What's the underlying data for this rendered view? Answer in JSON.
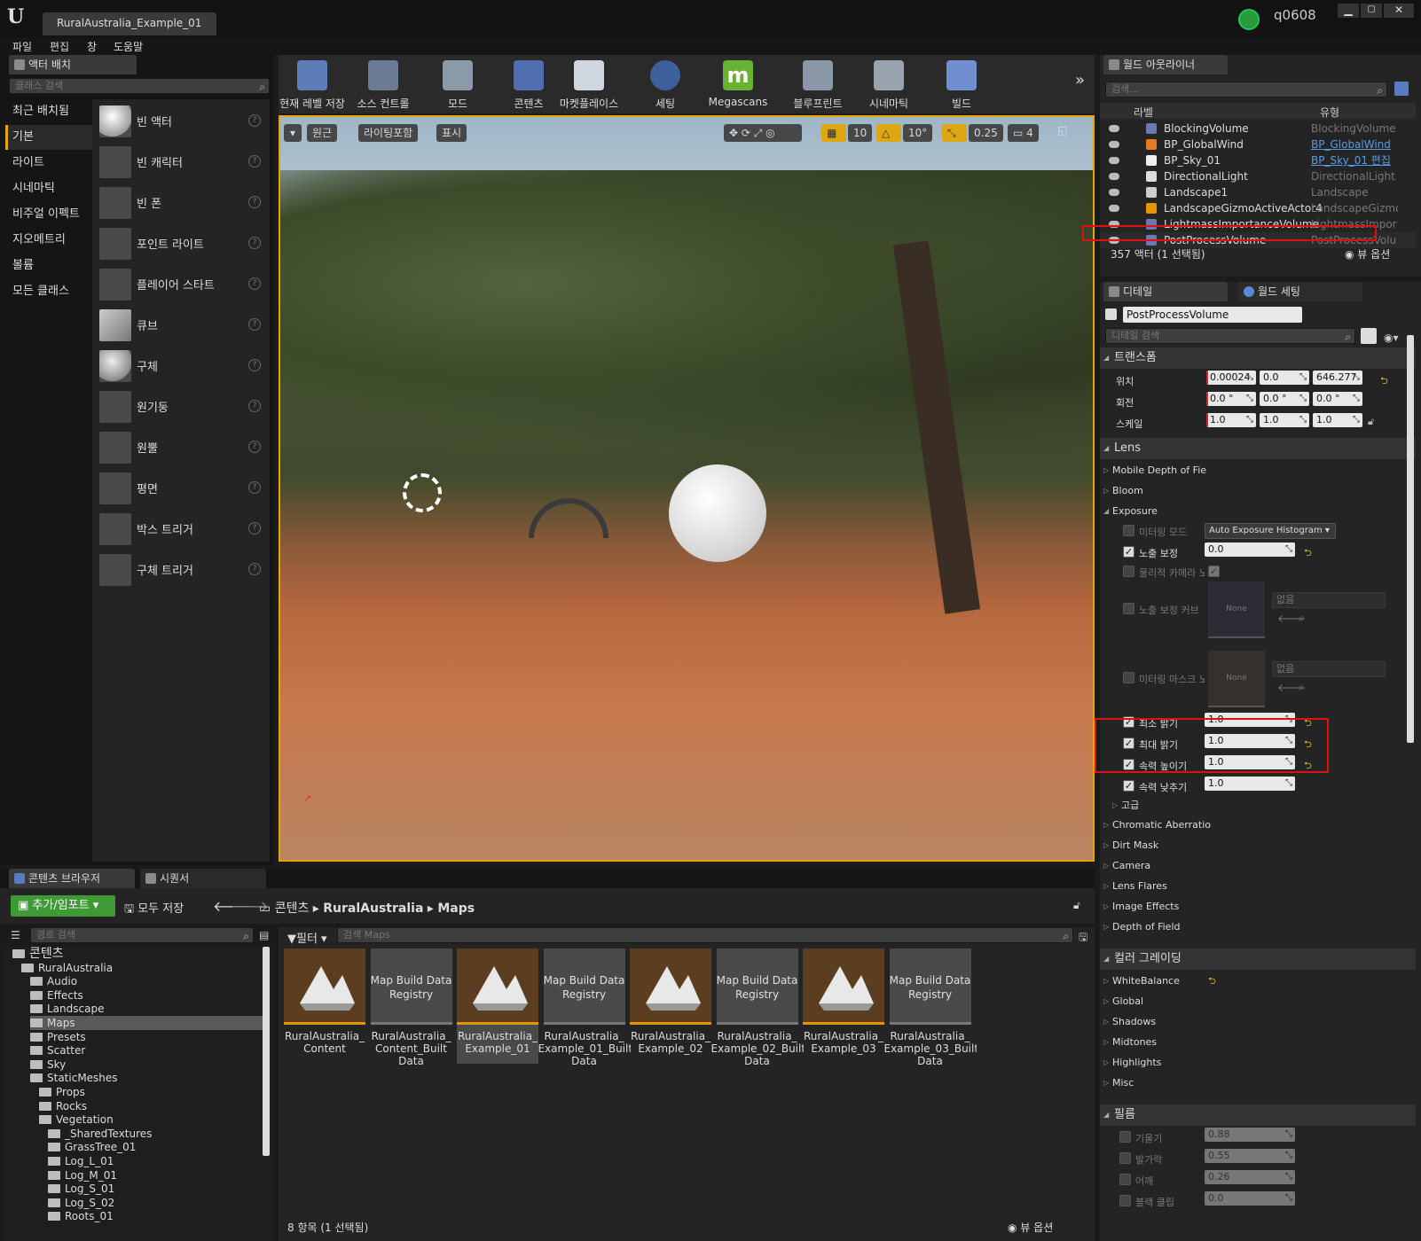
{
  "window": {
    "tab_title": "RuralAustralia_Example_01",
    "user": "q0608"
  },
  "menu": [
    "파일",
    "편집",
    "창",
    "도움말"
  ],
  "place_actors": {
    "tab_label": "액터 배치",
    "search_placeholder": "클래스 검색",
    "categories": [
      "최근 배치됨",
      "기본",
      "라이트",
      "시네마틱",
      "비주얼 이펙트",
      "지오메트리",
      "볼륨",
      "모든 클래스"
    ],
    "selected_category": "기본",
    "items": [
      "빈 액터",
      "빈 캐릭터",
      "빈 폰",
      "포인트 라이트",
      "플레이어 스타트",
      "큐브",
      "구체",
      "원기둥",
      "원뿔",
      "평면",
      "박스 트리거",
      "구체 트리거"
    ]
  },
  "toolbar": {
    "buttons": [
      "현재 레벨 저장",
      "소스 컨트롤",
      "모드",
      "콘텐츠",
      "마켓플레이스",
      "세팅",
      "Megascans",
      "블루프린트",
      "시네마틱",
      "빌드"
    ]
  },
  "viewport": {
    "view_mode": "원근",
    "lighting": "라이팅포함",
    "show": "표시",
    "grid_snap": "10",
    "rot_snap": "10°",
    "scale_snap": "0.25",
    "cam_speed": "4"
  },
  "outliner": {
    "tab_label": "월드 아웃라이너",
    "search_placeholder": "검색...",
    "col_label": "라벨",
    "col_type": "유형",
    "rows": [
      {
        "name": "BlockingVolume",
        "type": "BlockingVolume",
        "link": false
      },
      {
        "name": "BP_GlobalWind",
        "type": "BP_GlobalWind",
        "link": true
      },
      {
        "name": "BP_Sky_01",
        "type": "BP_Sky_01 편집",
        "link": true
      },
      {
        "name": "DirectionalLight",
        "type": "DirectionalLight",
        "link": false
      },
      {
        "name": "Landscape1",
        "type": "Landscape",
        "link": false
      },
      {
        "name": "LandscapeGizmoActiveActor4",
        "type": "LandscapeGizmo",
        "link": false
      },
      {
        "name": "LightmassImportanceVolume",
        "type": "LightmassImpor",
        "link": false
      },
      {
        "name": "PostProcessVolume",
        "type": "PostProcessVolu",
        "link": false
      }
    ],
    "status": "357 액터 (1 선택됨)",
    "view_options": "뷰 옵션"
  },
  "details": {
    "tab_label": "디테일",
    "world_settings_tab": "월드 세팅",
    "actor_name": "PostProcessVolume",
    "search_placeholder": "디테일 검색",
    "transform": {
      "header": "트랜스폼",
      "location_label": "위치",
      "location": [
        "0.00024",
        "0.0",
        "646.277"
      ],
      "rotation_label": "회전",
      "rotation": [
        "0.0 °",
        "0.0 °",
        "0.0 °"
      ],
      "scale_label": "스케일",
      "scale": [
        "1.0",
        "1.0",
        "1.0"
      ]
    },
    "lens": {
      "header": "Lens",
      "sub": [
        "Mobile Depth of Fie",
        "Bloom",
        "Exposure"
      ],
      "metering_mode_label": "미터링 모드",
      "metering_mode_value": "Auto Exposure Histogram",
      "exposure_comp_label": "노출 보정",
      "exposure_comp_value": "0.0",
      "physical_camera_label": "물리적 카메라 노",
      "exposure_curve_label": "노출 보정 커브",
      "metering_mask_label": "미터링 마스크 노",
      "none_label": "None",
      "none_dropdown": "없음",
      "min_brightness_label": "최소 밝기",
      "min_brightness_value": "1.0",
      "max_brightness_label": "최대 밝기",
      "max_brightness_value": "1.0",
      "speed_up_label": "속력 높이기",
      "speed_up_value": "1.0",
      "speed_down_label": "속력 낮추기",
      "speed_down_value": "1.0",
      "advanced_label": "고급",
      "sub2": [
        "Chromatic Aberratio",
        "Dirt Mask",
        "Camera",
        "Lens Flares",
        "Image Effects",
        "Depth of Field"
      ]
    },
    "color_grading": {
      "header": "컬러 그레이딩",
      "sub": [
        "WhiteBalance",
        "Global",
        "Shadows",
        "Midtones",
        "Highlights",
        "Misc"
      ]
    },
    "film": {
      "header": "필름",
      "rows": [
        {
          "label": "기울기",
          "value": "0.88"
        },
        {
          "label": "발가락",
          "value": "0.55"
        },
        {
          "label": "어깨",
          "value": "0.26"
        },
        {
          "label": "블랙 클립",
          "value": "0.0"
        }
      ]
    }
  },
  "content_browser": {
    "tab_label": "콘텐츠 브라우저",
    "sequencer_tab": "시퀀서",
    "add_import": "추가/임포트",
    "save_all": "모두 저장",
    "breadcrumb": [
      "콘텐츠",
      "RuralAustralia",
      "Maps"
    ],
    "path_search_placeholder": "경로 검색",
    "filter_label": "필터",
    "asset_search_placeholder": "검색 Maps",
    "tree": [
      {
        "label": "콘텐츠",
        "depth": 0
      },
      {
        "label": "RuralAustralia",
        "depth": 1
      },
      {
        "label": "Audio",
        "depth": 2
      },
      {
        "label": "Effects",
        "depth": 2
      },
      {
        "label": "Landscape",
        "depth": 2
      },
      {
        "label": "Maps",
        "depth": 2,
        "selected": true
      },
      {
        "label": "Presets",
        "depth": 2
      },
      {
        "label": "Scatter",
        "depth": 2
      },
      {
        "label": "Sky",
        "depth": 2
      },
      {
        "label": "StaticMeshes",
        "depth": 2
      },
      {
        "label": "Props",
        "depth": 3
      },
      {
        "label": "Rocks",
        "depth": 3
      },
      {
        "label": "Vegetation",
        "depth": 3
      },
      {
        "label": "_SharedTextures",
        "depth": 4
      },
      {
        "label": "GrassTree_01",
        "depth": 4
      },
      {
        "label": "Log_L_01",
        "depth": 4
      },
      {
        "label": "Log_M_01",
        "depth": 4
      },
      {
        "label": "Log_S_01",
        "depth": 4
      },
      {
        "label": "Log_S_02",
        "depth": 4
      },
      {
        "label": "Roots_01",
        "depth": 4
      }
    ],
    "assets": [
      {
        "name": "RuralAustralia_ Content",
        "kind": "map"
      },
      {
        "name": "RuralAustralia_ Content_Built Data",
        "kind": "registry"
      },
      {
        "name": "RuralAustralia_ Example_01",
        "kind": "map",
        "selected": true
      },
      {
        "name": "RuralAustralia_ Example_01_Built Data",
        "kind": "registry"
      },
      {
        "name": "RuralAustralia_ Example_02",
        "kind": "map"
      },
      {
        "name": "RuralAustralia_ Example_02_Built Data",
        "kind": "registry"
      },
      {
        "name": "RuralAustralia_ Example_03",
        "kind": "map"
      },
      {
        "name": "RuralAustralia_ Example_03_Built Data",
        "kind": "registry"
      }
    ],
    "registry_label": "Map Build Data Registry",
    "status": "8 항목 (1 선택됨)",
    "view_options": "뷰 옵션"
  },
  "colors": {
    "accent": "#e6a500",
    "highlight_red": "#e01010",
    "link_blue": "#5a9ae0"
  }
}
